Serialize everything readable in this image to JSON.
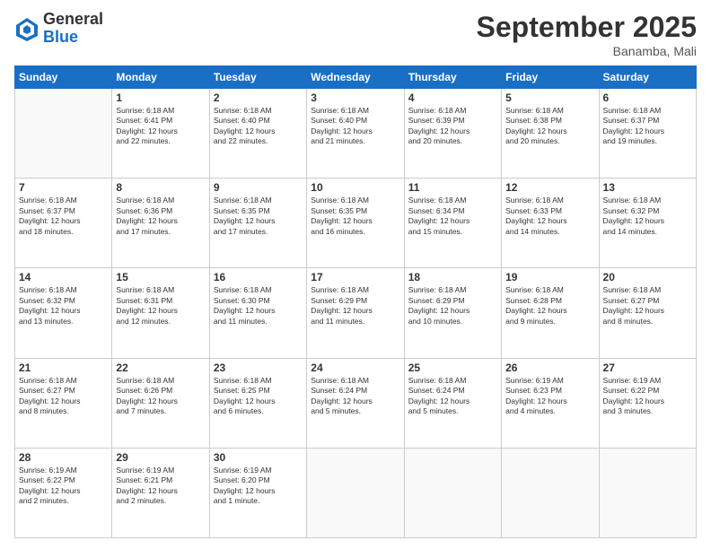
{
  "logo": {
    "general": "General",
    "blue": "Blue"
  },
  "header": {
    "month_title": "September 2025",
    "location": "Banamba, Mali"
  },
  "weekdays": [
    "Sunday",
    "Monday",
    "Tuesday",
    "Wednesday",
    "Thursday",
    "Friday",
    "Saturday"
  ],
  "weeks": [
    [
      {
        "day": "",
        "info": ""
      },
      {
        "day": "1",
        "info": "Sunrise: 6:18 AM\nSunset: 6:41 PM\nDaylight: 12 hours\nand 22 minutes."
      },
      {
        "day": "2",
        "info": "Sunrise: 6:18 AM\nSunset: 6:40 PM\nDaylight: 12 hours\nand 22 minutes."
      },
      {
        "day": "3",
        "info": "Sunrise: 6:18 AM\nSunset: 6:40 PM\nDaylight: 12 hours\nand 21 minutes."
      },
      {
        "day": "4",
        "info": "Sunrise: 6:18 AM\nSunset: 6:39 PM\nDaylight: 12 hours\nand 20 minutes."
      },
      {
        "day": "5",
        "info": "Sunrise: 6:18 AM\nSunset: 6:38 PM\nDaylight: 12 hours\nand 20 minutes."
      },
      {
        "day": "6",
        "info": "Sunrise: 6:18 AM\nSunset: 6:37 PM\nDaylight: 12 hours\nand 19 minutes."
      }
    ],
    [
      {
        "day": "7",
        "info": "Sunrise: 6:18 AM\nSunset: 6:37 PM\nDaylight: 12 hours\nand 18 minutes."
      },
      {
        "day": "8",
        "info": "Sunrise: 6:18 AM\nSunset: 6:36 PM\nDaylight: 12 hours\nand 17 minutes."
      },
      {
        "day": "9",
        "info": "Sunrise: 6:18 AM\nSunset: 6:35 PM\nDaylight: 12 hours\nand 17 minutes."
      },
      {
        "day": "10",
        "info": "Sunrise: 6:18 AM\nSunset: 6:35 PM\nDaylight: 12 hours\nand 16 minutes."
      },
      {
        "day": "11",
        "info": "Sunrise: 6:18 AM\nSunset: 6:34 PM\nDaylight: 12 hours\nand 15 minutes."
      },
      {
        "day": "12",
        "info": "Sunrise: 6:18 AM\nSunset: 6:33 PM\nDaylight: 12 hours\nand 14 minutes."
      },
      {
        "day": "13",
        "info": "Sunrise: 6:18 AM\nSunset: 6:32 PM\nDaylight: 12 hours\nand 14 minutes."
      }
    ],
    [
      {
        "day": "14",
        "info": "Sunrise: 6:18 AM\nSunset: 6:32 PM\nDaylight: 12 hours\nand 13 minutes."
      },
      {
        "day": "15",
        "info": "Sunrise: 6:18 AM\nSunset: 6:31 PM\nDaylight: 12 hours\nand 12 minutes."
      },
      {
        "day": "16",
        "info": "Sunrise: 6:18 AM\nSunset: 6:30 PM\nDaylight: 12 hours\nand 11 minutes."
      },
      {
        "day": "17",
        "info": "Sunrise: 6:18 AM\nSunset: 6:29 PM\nDaylight: 12 hours\nand 11 minutes."
      },
      {
        "day": "18",
        "info": "Sunrise: 6:18 AM\nSunset: 6:29 PM\nDaylight: 12 hours\nand 10 minutes."
      },
      {
        "day": "19",
        "info": "Sunrise: 6:18 AM\nSunset: 6:28 PM\nDaylight: 12 hours\nand 9 minutes."
      },
      {
        "day": "20",
        "info": "Sunrise: 6:18 AM\nSunset: 6:27 PM\nDaylight: 12 hours\nand 8 minutes."
      }
    ],
    [
      {
        "day": "21",
        "info": "Sunrise: 6:18 AM\nSunset: 6:27 PM\nDaylight: 12 hours\nand 8 minutes."
      },
      {
        "day": "22",
        "info": "Sunrise: 6:18 AM\nSunset: 6:26 PM\nDaylight: 12 hours\nand 7 minutes."
      },
      {
        "day": "23",
        "info": "Sunrise: 6:18 AM\nSunset: 6:25 PM\nDaylight: 12 hours\nand 6 minutes."
      },
      {
        "day": "24",
        "info": "Sunrise: 6:18 AM\nSunset: 6:24 PM\nDaylight: 12 hours\nand 5 minutes."
      },
      {
        "day": "25",
        "info": "Sunrise: 6:18 AM\nSunset: 6:24 PM\nDaylight: 12 hours\nand 5 minutes."
      },
      {
        "day": "26",
        "info": "Sunrise: 6:19 AM\nSunset: 6:23 PM\nDaylight: 12 hours\nand 4 minutes."
      },
      {
        "day": "27",
        "info": "Sunrise: 6:19 AM\nSunset: 6:22 PM\nDaylight: 12 hours\nand 3 minutes."
      }
    ],
    [
      {
        "day": "28",
        "info": "Sunrise: 6:19 AM\nSunset: 6:22 PM\nDaylight: 12 hours\nand 2 minutes."
      },
      {
        "day": "29",
        "info": "Sunrise: 6:19 AM\nSunset: 6:21 PM\nDaylight: 12 hours\nand 2 minutes."
      },
      {
        "day": "30",
        "info": "Sunrise: 6:19 AM\nSunset: 6:20 PM\nDaylight: 12 hours\nand 1 minute."
      },
      {
        "day": "",
        "info": ""
      },
      {
        "day": "",
        "info": ""
      },
      {
        "day": "",
        "info": ""
      },
      {
        "day": "",
        "info": ""
      }
    ]
  ]
}
